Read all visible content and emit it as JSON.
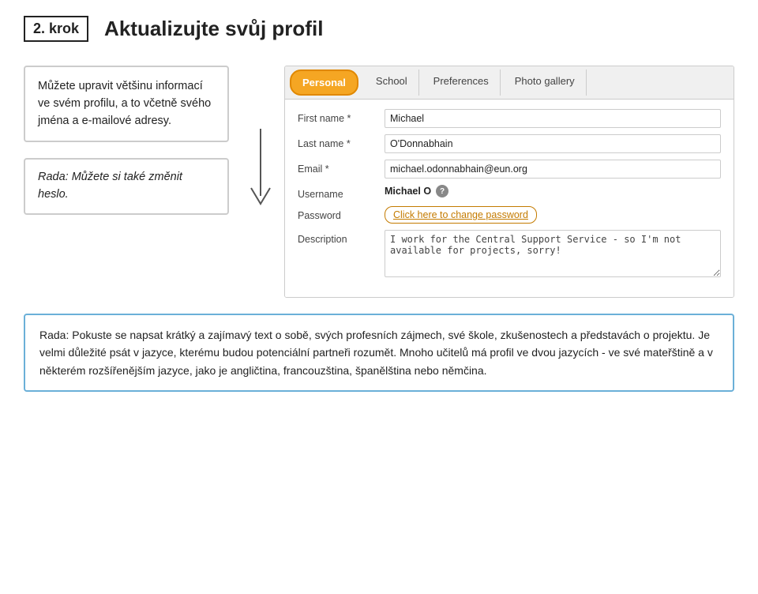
{
  "header": {
    "step_label": "2. krok",
    "title": "Aktualizujte svůj profil"
  },
  "left": {
    "info_text": "Můžete upravit většinu informací ve svém profilu, a to včetně svého jména a e-mailové adresy.",
    "tip_text": "Rada: Můžete si také změnit heslo."
  },
  "tabs": [
    {
      "label": "Personal",
      "active": true
    },
    {
      "label": "School",
      "active": false
    },
    {
      "label": "Preferences",
      "active": false
    },
    {
      "label": "Photo gallery",
      "active": false
    }
  ],
  "form": {
    "fields": [
      {
        "label": "First name *",
        "value": "Michael",
        "type": "input"
      },
      {
        "label": "Last name *",
        "value": "O'Donnabhain",
        "type": "input"
      },
      {
        "label": "Email *",
        "value": "michael.odonnabhain@eun.org",
        "type": "input"
      },
      {
        "label": "Username",
        "value": "Michael O",
        "type": "username"
      },
      {
        "label": "Password",
        "value": "Click here to change password",
        "type": "password-link"
      },
      {
        "label": "Description",
        "value": "I work for the Central Support Service - so I'm not available for projects, sorry!",
        "type": "textarea"
      }
    ]
  },
  "bottom_tip": {
    "text": "Rada: Pokuste se napsat krátký a zajímavý text o sobě, svých profesních zájmech, své škole, zkušenostech a představách o projektu. Je velmi důležité psát v jazyce, kterému budou potenciální partneři rozumět. Mnoho učitelů má profil ve dvou jazycích - ve své mateřštině a  v některém rozšířenějším jazyce, jako je angličtina, francouzština, španělština nebo němčina."
  }
}
